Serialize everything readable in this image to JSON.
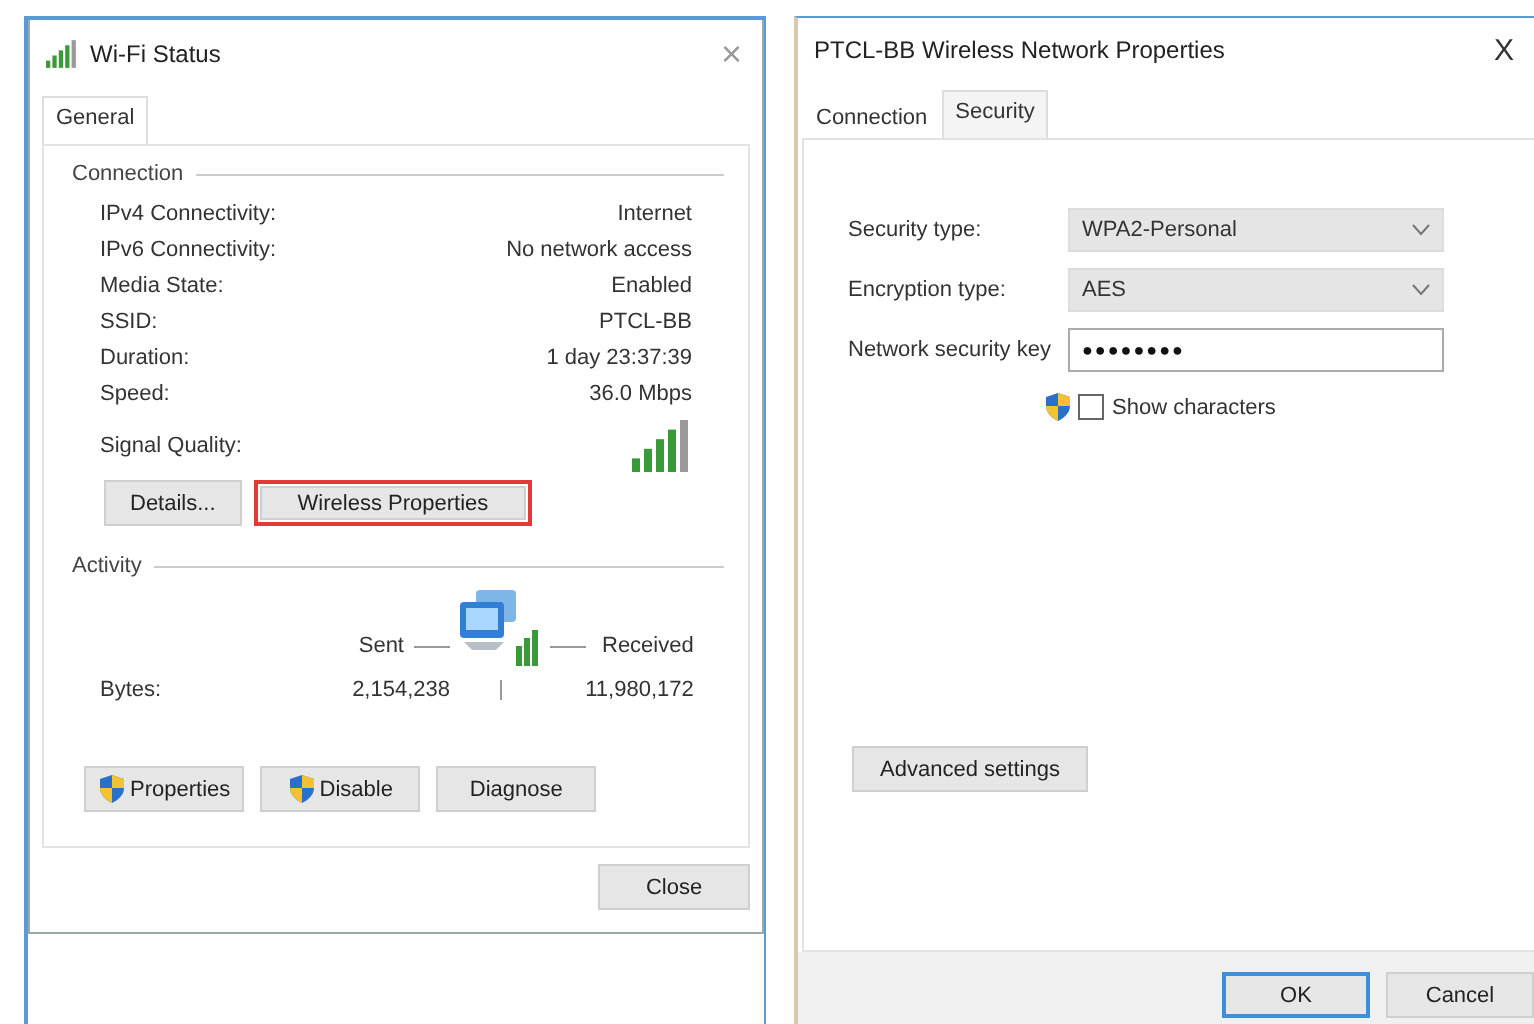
{
  "status_window": {
    "title": "Wi-Fi Status",
    "close": "×",
    "tabs": [
      {
        "label": "General",
        "selected": true
      }
    ],
    "connection": {
      "heading": "Connection",
      "rows": [
        {
          "label": "IPv4 Connectivity:",
          "value": "Internet"
        },
        {
          "label": "IPv6 Connectivity:",
          "value": "No network access"
        },
        {
          "label": "Media State:",
          "value": "Enabled"
        },
        {
          "label": "SSID:",
          "value": "PTCL-BB"
        },
        {
          "label": "Duration:",
          "value": "1 day 23:37:39"
        },
        {
          "label": "Speed:",
          "value": "36.0 Mbps"
        }
      ],
      "signal_label": "Signal Quality:",
      "buttons": [
        {
          "label": "Details...",
          "highlighted": false
        },
        {
          "label": "Wireless Properties",
          "highlighted": true
        }
      ]
    },
    "activity": {
      "heading": "Activity",
      "sent_label": "Sent",
      "received_label": "Received",
      "bytes_label": "Bytes:",
      "sent": "2,154,238",
      "received": "11,980,172"
    },
    "buttons": [
      {
        "label": "Properties",
        "shield": true
      },
      {
        "label": "Disable",
        "shield": true
      },
      {
        "label": "Diagnose",
        "shield": false
      }
    ],
    "close_button": "Close"
  },
  "properties_window": {
    "title": "PTCL-BB Wireless Network Properties",
    "close": "X",
    "tabs": [
      {
        "label": "Connection",
        "selected": false
      },
      {
        "label": "Security",
        "selected": true
      }
    ],
    "fields": [
      {
        "label": "Security type:",
        "value": "WPA2-Personal",
        "kind": "select"
      },
      {
        "label": "Encryption type:",
        "value": "AES",
        "kind": "select"
      },
      {
        "label": "Network security key",
        "value": "●●●●●●●●",
        "kind": "password"
      }
    ],
    "show_characters": {
      "label": "Show characters",
      "checked": false
    },
    "advanced_button": "Advanced settings",
    "buttons": [
      {
        "label": "OK",
        "default": true
      },
      {
        "label": "Cancel",
        "default": false
      }
    ]
  }
}
